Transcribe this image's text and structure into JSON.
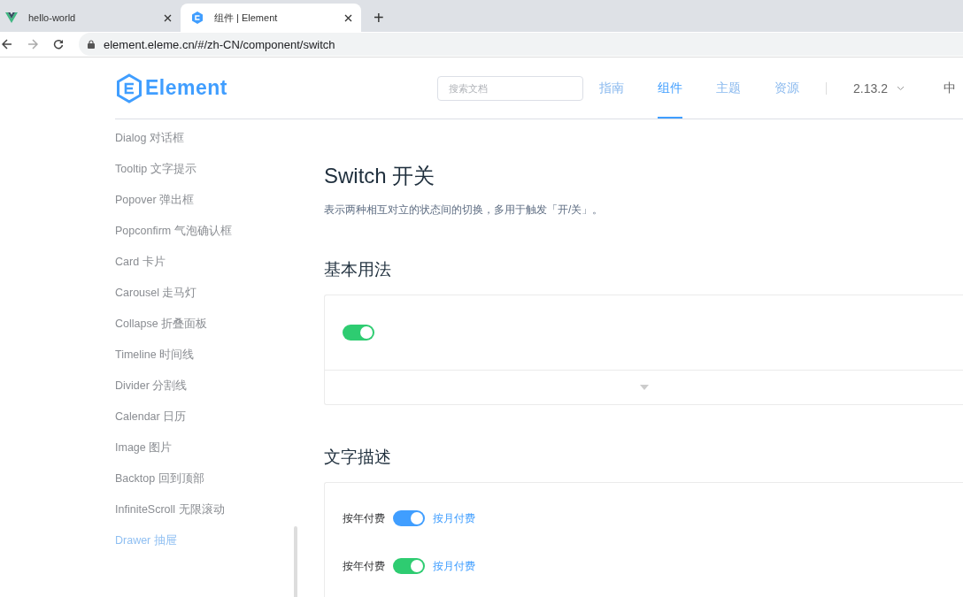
{
  "browser": {
    "tabs": [
      {
        "title": "hello-world",
        "selected": false,
        "kind": "vue"
      },
      {
        "title": "组件 | Element",
        "selected": true,
        "kind": "element"
      }
    ],
    "new_tab": "+",
    "address": "element.eleme.cn/#/zh-CN/component/switch"
  },
  "header": {
    "logo": "Element",
    "search": {
      "placeholder": "搜索文档"
    },
    "nav": [
      {
        "label": "指南",
        "selected": false
      },
      {
        "label": "组件",
        "selected": true
      },
      {
        "label": "主题",
        "selected": false
      },
      {
        "label": "资源",
        "selected": false
      }
    ],
    "version": "2.13.2",
    "language": "中"
  },
  "sidebar": {
    "items": [
      {
        "label": "Dialog 对话框",
        "selected": false
      },
      {
        "label": "Tooltip 文字提示",
        "selected": false
      },
      {
        "label": "Popover 弹出框",
        "selected": false
      },
      {
        "label": "Popconfirm 气泡确认框",
        "selected": false
      },
      {
        "label": "Card 卡片",
        "selected": false
      },
      {
        "label": "Carousel 走马灯",
        "selected": false
      },
      {
        "label": "Collapse 折叠面板",
        "selected": false
      },
      {
        "label": "Timeline 时间线",
        "selected": false
      },
      {
        "label": "Divider 分割线",
        "selected": false
      },
      {
        "label": "Calendar 日历",
        "selected": false
      },
      {
        "label": "Image 图片",
        "selected": false
      },
      {
        "label": "Backtop 回到顶部",
        "selected": false
      },
      {
        "label": "InfiniteScroll 无限滚动",
        "selected": false
      },
      {
        "label": "Drawer 抽屉",
        "selected": true
      }
    ]
  },
  "content": {
    "title": "Switch 开关",
    "description": "表示两种相互对立的状态间的切换，多用于触发「开/关」。",
    "sections": [
      {
        "heading": "基本用法",
        "switches": [
          {
            "on": true,
            "color": "#2ecc71"
          }
        ],
        "expandable": true
      },
      {
        "heading": "文字描述",
        "switches": [
          {
            "on": true,
            "color": "#409eff",
            "inactive_text": "按年付费",
            "active_text": "按月付费"
          },
          {
            "on": true,
            "color": "#2ecc71",
            "inactive_text": "按年付费",
            "active_text": "按月付费"
          }
        ],
        "expandable": false
      }
    ]
  }
}
